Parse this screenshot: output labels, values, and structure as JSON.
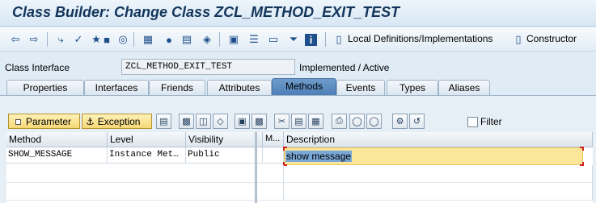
{
  "window": {
    "title": "Class Builder: Change Class ZCL_METHOD_EXIT_TEST"
  },
  "toolbar": {
    "icons": [
      "back-icon",
      "forward-icon",
      "other-object-icon",
      "check-icon",
      "test-icon",
      "activate-icon",
      "where-used-icon",
      "display-object-list-icon",
      "hierarchy-icon",
      "bulb-icon",
      "window-icon",
      "navigation-icon",
      "tree-icon",
      "superclass-icon",
      "sub-class-icon",
      "filter-icon",
      "info-icon"
    ],
    "local_definitions_label": "Local Definitions/Implementations",
    "constructor_label": "Constructor"
  },
  "interface": {
    "label": "Class Interface",
    "value": "ZCL_METHOD_EXIT_TEST",
    "status": "Implemented / Active"
  },
  "tabs": [
    {
      "label": "Properties"
    },
    {
      "label": "Interfaces"
    },
    {
      "label": "Friends"
    },
    {
      "label": "Attributes"
    },
    {
      "label": "Methods"
    },
    {
      "label": "Events"
    },
    {
      "label": "Types"
    },
    {
      "label": "Aliases"
    }
  ],
  "active_tab": "Methods",
  "method_toolbar": {
    "parameter_label": "Parameter",
    "exception_label": "Exception",
    "filter_label": "Filter"
  },
  "table": {
    "headers": {
      "method": "Method",
      "level": "Level",
      "visibility": "Visibility",
      "m": "M...",
      "description": "Description"
    },
    "rows": [
      {
        "method": "SHOW_MESSAGE",
        "level": "Instance Met…",
        "visibility": "Public",
        "description": "show message"
      }
    ]
  },
  "colors": {
    "accent": "#4d7fb6",
    "title": "#13355b",
    "highlight": "#fbe69a"
  }
}
